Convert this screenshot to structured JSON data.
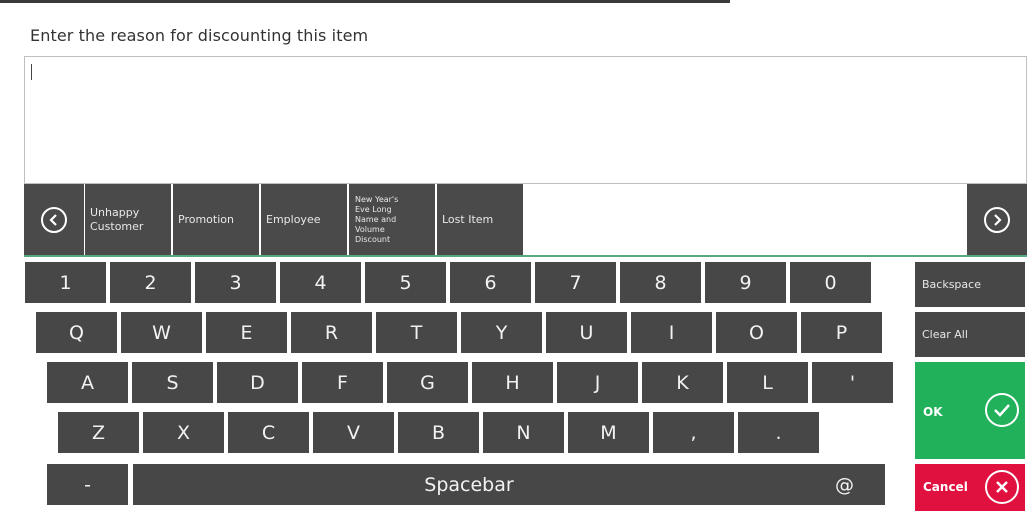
{
  "prompt": "Enter the reason for discounting this item",
  "reason_input": {
    "value": ""
  },
  "reasons": [
    "Unhappy Customer",
    "Promotion",
    "Employee",
    "New Year's Eve Long Name and Volume Discount",
    "Lost Item"
  ],
  "keys": {
    "row1": [
      "1",
      "2",
      "3",
      "4",
      "5",
      "6",
      "7",
      "8",
      "9",
      "0"
    ],
    "row2": [
      "Q",
      "W",
      "E",
      "R",
      "T",
      "Y",
      "U",
      "I",
      "O",
      "P"
    ],
    "row3": [
      "A",
      "S",
      "D",
      "F",
      "G",
      "H",
      "J",
      "K",
      "L",
      "'"
    ],
    "row4": [
      "Z",
      "X",
      "C",
      "V",
      "B",
      "N",
      "M",
      ",",
      "."
    ],
    "dash": "-",
    "spacebar": "Spacebar",
    "at": "@"
  },
  "actions": {
    "backspace": "Backspace",
    "clear_all": "Clear All",
    "ok": "OK",
    "cancel": "Cancel"
  },
  "colors": {
    "key": "#474747",
    "ok": "#21b15a",
    "cancel": "#e0103f",
    "accent_line": "#5aa87e"
  },
  "icons": {
    "prev": "chevron-left-circle-icon",
    "next": "chevron-right-circle-icon",
    "ok": "check-circle-icon",
    "cancel": "x-circle-icon"
  }
}
